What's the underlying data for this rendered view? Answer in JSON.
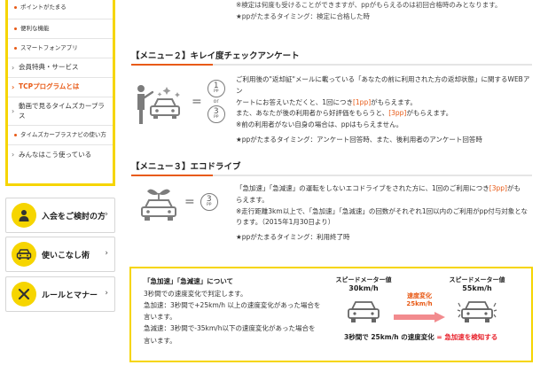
{
  "sidebar": {
    "items": [
      {
        "label": "ポイントがたまる",
        "type": "sub"
      },
      {
        "label": "便利な機能",
        "type": "sub"
      },
      {
        "label": "スマートフォンアプリ",
        "type": "sub"
      },
      {
        "label": "会員特典・サービス",
        "type": "main"
      },
      {
        "label": "TCPプログラムとは",
        "type": "active"
      },
      {
        "label": "動画で見るタイムズカープラス",
        "type": "main"
      },
      {
        "label": "タイムズカープラスナビの使い方",
        "type": "sub"
      },
      {
        "label": "みんなはこう使っている",
        "type": "main"
      }
    ],
    "buttons": [
      {
        "label": "入会をご検討の方",
        "icon": "person-icon"
      },
      {
        "label": "使いこなし術",
        "icon": "car-icon"
      },
      {
        "label": "ルールとマナー",
        "icon": "no-entry-icon"
      }
    ]
  },
  "top_note": {
    "line1": "※検定は何度も受けることができますが、ppがもらえるのは初回合格時のみとなります。",
    "line2": "★ppがたまるタイミング：検定に合格した時"
  },
  "menu2": {
    "title": "【メニュー２】キレイ度チェックアンケート",
    "pp_top": "1",
    "pp_or": "or",
    "pp_bottom": "3",
    "pp_unit": "PP",
    "equals": "=",
    "p1_a": "ご利用後の\"返却証\"メールに載っている「あなたの前に利用された方の返却状態」に関するWEBアン",
    "p1_b": "ケートにお答えいただくと、1回につき",
    "p1_hl": "[1pp]",
    "p1_c": "がもらえます。",
    "p2_a": "また、あなたが後の利用者から好評価をもらうと、",
    "p2_hl": "[3pp]",
    "p2_b": "がもらえます。",
    "p3": "※前の利用者がない自身の場合は、ppはもらえません。",
    "timing": "★ppがたまるタイミング：アンケート回答時、また、後利用者のアンケート回答時"
  },
  "menu3": {
    "title": "【メニュー３】エコドライブ",
    "pp": "3",
    "pp_unit": "PP",
    "equals": "=",
    "p1_a": "「急加速」「急減速」の運転をしないエコドライブをされた方に、1回のご利用につき",
    "p1_hl": "[3pp]",
    "p1_b": "がも",
    "p1_c": "らえます。",
    "p2": "※走行距離3km以上で、「急加速」「急減速」の回数がそれぞれ1回以内のご利用がpp付与対象とな",
    "p3": "ります。（2015年1月30日より）",
    "timing": "★ppがたまるタイミング：利用終了時"
  },
  "infobox": {
    "head": "「急加速」「急減速」について",
    "line1": "3秒間での速度変化で判定します。",
    "line2": "急加速：3秒間で+25km/h 以上の速度変化があった場合を",
    "line3": "言います。",
    "line4": "急減速：3秒間で-35km/h以下の速度変化があった場合を",
    "line5": "言います。",
    "speed_label": "スピードメーター値",
    "speed_before": "30km/h",
    "speed_after": "55km/h",
    "change_label": "速度変化",
    "change_value": "25km/h",
    "bottom_a": "3秒間で 25km/h の速度変化",
    "bottom_eq": "=",
    "bottom_b": "急加速を検知する"
  },
  "colors": {
    "accent": "#e85a16",
    "yellow": "#f6d500",
    "red": "#e8202a"
  }
}
